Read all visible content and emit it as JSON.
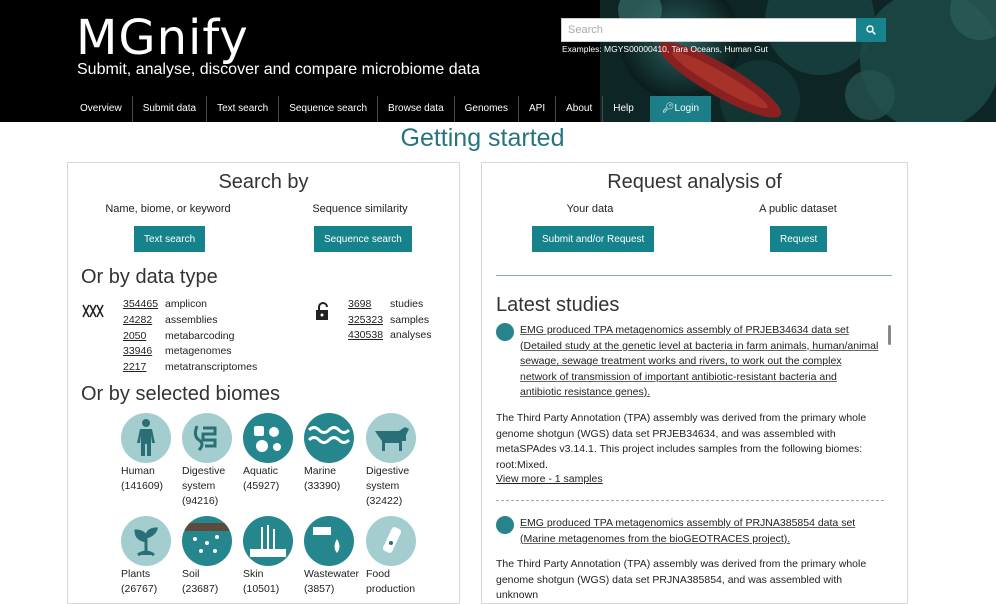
{
  "header": {
    "logo": "MGnify",
    "tagline": "Submit, analyse, discover and compare microbiome data",
    "search_placeholder": "Search",
    "search_examples": "Examples: MGYS00000410, Tara Oceans, Human Gut",
    "search_icon": "search-icon"
  },
  "nav": {
    "items": [
      "Overview",
      "Submit data",
      "Text search",
      "Sequence search",
      "Browse data",
      "Genomes",
      "API",
      "About",
      "Help"
    ],
    "login": "Login"
  },
  "page_title": "Getting started",
  "search_by": {
    "heading": "Search by",
    "col1_label": "Name, biome, or keyword",
    "col1_button": "Text search",
    "col2_label": "Sequence similarity",
    "col2_button": "Sequence search"
  },
  "data_type": {
    "heading": "Or by data type",
    "left": [
      {
        "count": "354465",
        "label": "amplicon"
      },
      {
        "count": "24282",
        "label": "assemblies"
      },
      {
        "count": "2050",
        "label": "metabarcoding"
      },
      {
        "count": "33946",
        "label": "metagenomes"
      },
      {
        "count": "2217",
        "label": "metatranscriptomes"
      }
    ],
    "right": [
      {
        "count": "3698",
        "label": "studies"
      },
      {
        "count": "325323",
        "label": "samples"
      },
      {
        "count": "430538",
        "label": "analyses"
      }
    ]
  },
  "biomes": {
    "heading": "Or by selected biomes",
    "items": [
      {
        "name": "Human",
        "count": "(141609)",
        "icon": "human-icon"
      },
      {
        "name": "Digestive system",
        "count": "(94216)",
        "icon": "digestive-icon"
      },
      {
        "name": "Aquatic",
        "count": "(45927)",
        "icon": "aquatic-icon"
      },
      {
        "name": "Marine",
        "count": "(33390)",
        "icon": "marine-icon"
      },
      {
        "name": "Digestive system",
        "count": "(32422)",
        "icon": "cow-icon"
      },
      {
        "name": "Plants",
        "count": "(26767)",
        "icon": "plant-icon"
      },
      {
        "name": "Soil",
        "count": "(23687)",
        "icon": "soil-icon"
      },
      {
        "name": "Skin",
        "count": "(10501)",
        "icon": "skin-icon"
      },
      {
        "name": "Wastewater",
        "count": "(3857)",
        "icon": "wastewater-icon"
      },
      {
        "name": "Food production",
        "count": "",
        "icon": "food-icon"
      }
    ]
  },
  "request": {
    "heading": "Request analysis of",
    "col1_label": "Your data",
    "col1_button": "Submit and/or Request",
    "col2_label": "A public dataset",
    "col2_button": "Request"
  },
  "latest": {
    "heading": "Latest studies",
    "studies": [
      {
        "title": "EMG produced TPA metagenomics assembly of PRJEB34634 data set (Detailed study at the genetic level at bacteria in farm animals, human/animal sewage, sewage treatment works and rivers, to work out the complex network of transmission of important antibiotic-resistant bacteria and antibiotic resistance genes).",
        "description": "The Third Party Annotation (TPA) assembly was derived from the primary whole genome shotgun (WGS) data set PRJEB34634, and was assembled with metaSPAdes v3.14.1. This project includes samples from the following biomes: root:Mixed.",
        "view_more": "View more - 1 samples"
      },
      {
        "title": "EMG produced TPA metagenomics assembly of PRJNA385854 data set (Marine metagenomes from the bioGEOTRACES project).",
        "description": "The Third Party Annotation (TPA) assembly was derived from the primary whole genome shotgun (WGS) data set PRJNA385854, and was assembled with unknown"
      }
    ]
  },
  "colors": {
    "teal": "#16828c",
    "title_teal": "#27747e",
    "biome_light": "#a4cdd0",
    "biome_dark": "#25868e"
  }
}
